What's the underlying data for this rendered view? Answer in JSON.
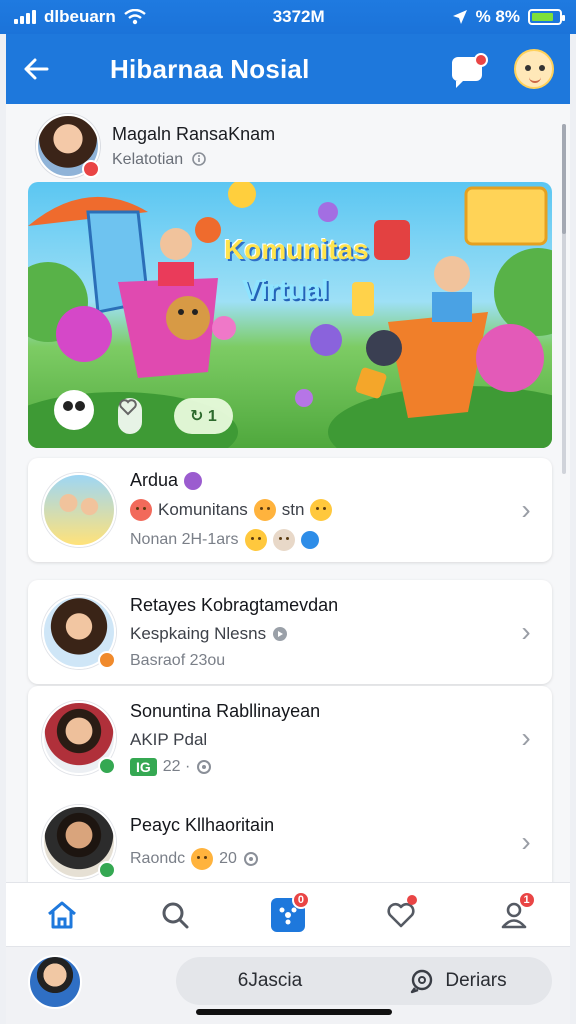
{
  "status_bar": {
    "carrier": "dlbeuarn",
    "time": "3372M",
    "battery_text": "% 8%",
    "battery_level": 0.8,
    "icons": [
      "signal-icon",
      "wifi-icon",
      "location-arrow-icon",
      "battery-icon"
    ]
  },
  "header": {
    "title": "Hibarnaa Nosial",
    "back_icon": "arrow-left-icon",
    "chat_icon": "chat-bubble-icon",
    "mascot_icon": "mascot-avatar-icon",
    "color": "#1e78dc"
  },
  "post": {
    "author": "Magaln RansaKnam",
    "subtitle": "Kelatotian",
    "subtitle_icon": "info-icon",
    "banner": {
      "title_line1": "Komunitas",
      "title_line2": "Virtual",
      "reaction_pill": "",
      "action_pill": "↻ 1"
    }
  },
  "list": [
    {
      "title": "Ardua",
      "line": "Komunitans",
      "line_extra": "stn",
      "meta": "Nonan 2H-1ars",
      "status_color": "#9b5ccf"
    },
    {
      "title": "Retayes Kobragtamevdan",
      "line": "Kespkaing Nlesns",
      "meta": "Basraof 23ou",
      "status_color": "#f08a2c"
    },
    {
      "title": "Sonuntina Rabllinayean",
      "line": "AKIP Pdal",
      "tag": "IG",
      "meta": "22 ·",
      "status_color": "#35a852"
    },
    {
      "title": "Peayc Kllhaoritain",
      "line": "Raondc",
      "meta": "20",
      "status_color": "#35a852"
    }
  ],
  "bottom_nav": {
    "items": [
      {
        "name": "home",
        "icon": "home-icon"
      },
      {
        "name": "search",
        "icon": "search-icon"
      },
      {
        "name": "community",
        "icon": "community-icon",
        "badge": "0"
      },
      {
        "name": "favorites",
        "icon": "heart-icon"
      },
      {
        "name": "profile",
        "icon": "person-icon",
        "badge": "1"
      }
    ]
  },
  "footer": {
    "left_label": "6Jascia",
    "right_label": "Deriars",
    "right_icon": "chat-search-icon"
  },
  "colors": {
    "accent": "#1e78dc",
    "badge_red": "#e94545",
    "online_green": "#35a852"
  }
}
